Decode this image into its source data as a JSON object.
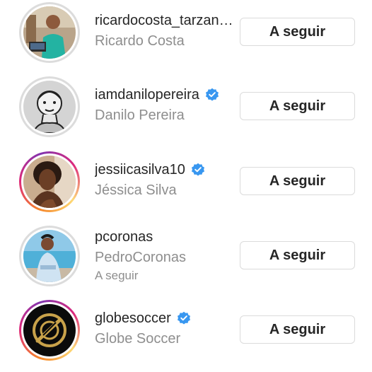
{
  "accounts": [
    {
      "username": "ricardocosta_tarzan…",
      "full_name": "Ricardo Costa",
      "verified": false,
      "story_ring": false,
      "button_label": "A seguir",
      "avatar_icon": "person-photo"
    },
    {
      "username": "iamdanilopereira",
      "full_name": "Danilo Pereira",
      "verified": true,
      "story_ring": false,
      "button_label": "A seguir",
      "avatar_icon": "sketch-portrait"
    },
    {
      "username": "jessiicasilva10",
      "full_name": "Jéssica Silva",
      "verified": true,
      "story_ring": true,
      "button_label": "A seguir",
      "avatar_icon": "person-photo"
    },
    {
      "username": "pcoronas",
      "full_name": "PedroCoronas",
      "subtitle": "A seguir",
      "verified": false,
      "story_ring": false,
      "button_label": "A seguir",
      "avatar_icon": "person-photo"
    },
    {
      "username": "globesoccer",
      "full_name": "Globe Soccer",
      "verified": true,
      "story_ring": true,
      "button_label": "A seguir",
      "avatar_icon": "globe-soccer-logo"
    }
  ],
  "colors": {
    "verified_badge": "#3897f0",
    "username_text": "#262626",
    "secondary_text": "#8e8e8e",
    "button_border": "#dbdbdb"
  }
}
